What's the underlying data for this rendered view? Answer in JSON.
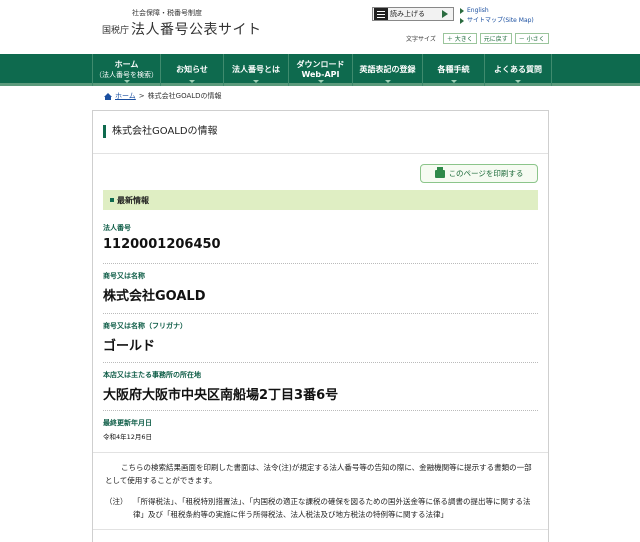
{
  "header": {
    "agency_sub": "社会保障・税番号制度",
    "agency": "国税庁",
    "site_title": "法人番号公表サイト",
    "speech_label": "読み上げる",
    "english_link": "English",
    "sitemap_link": "サイトマップ(Site Map)",
    "font_size_label": "文字サイズ",
    "font_large": "＋ 大きく",
    "font_reset": "元に戻す",
    "font_small": "－ 小さく"
  },
  "nav": {
    "items": [
      {
        "label": "ホーム",
        "sub": "（法人番号を検索）"
      },
      {
        "label": "お知らせ"
      },
      {
        "label": "法人番号とは"
      },
      {
        "label": "ダウンロード",
        "sub": "Web-API"
      },
      {
        "label": "英語表記の登録"
      },
      {
        "label": "各種手続"
      },
      {
        "label": "よくある質問"
      }
    ]
  },
  "breadcrumb": {
    "home": "ホーム",
    "sep": ">",
    "current": "株式会社GOALDの情報"
  },
  "main": {
    "title": "株式会社GOALDの情報",
    "print_button": "このページを印刷する",
    "latest_heading": "最新情報",
    "fields": [
      {
        "label": "法人番号",
        "value": "1120001206450"
      },
      {
        "label": "商号又は名称",
        "value": "株式会社GOALD"
      },
      {
        "label": "商号又は名称（フリガナ）",
        "value": "ゴールド"
      },
      {
        "label": "本店又は主たる事務所の所在地",
        "value": "大阪府大阪市中央区南船場2丁目3番6号"
      },
      {
        "label": "最終更新年月日",
        "value": "令和4年12月6日"
      }
    ],
    "note1": "こちらの検索結果画面を印刷した書面は、法令(注)が規定する法人番号等の告知の際に、金融機関等に提示する書類の一部として使用することができます。",
    "note2_tag": "（注）",
    "note2": "「所得税法」、「租税特別措置法」、「内国税の適正な課税の確保を図るための国外送金等に係る調書の提出等に関する法律」及び「租税条約等の実施に伴う所得税法、法人税法及び地方税法の特例等に関する法律」"
  }
}
